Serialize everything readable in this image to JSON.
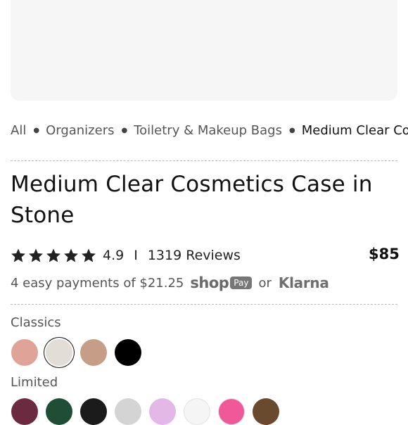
{
  "breadcrumb": {
    "items": [
      "All",
      "Organizers",
      "Toiletry & Makeup Bags",
      "Medium Clear Cosmetics Case in Stone"
    ]
  },
  "product": {
    "title": "Medium Clear Cosmetics Case in Stone",
    "rating": "4.9",
    "rating_stars": 5,
    "rating_separator": "I",
    "reviews": "1319 Reviews",
    "price": "$85"
  },
  "installments": {
    "text": "4 easy payments of $21.25",
    "shop_label": "shop",
    "pay_label": "Pay",
    "or": "or",
    "klarna": "Klarna"
  },
  "colors": {
    "classics_label": "Classics",
    "classics": [
      "#dfa398",
      "#e3ddd8",
      "#c69d86",
      "#000000"
    ],
    "classics_selected_index": 1,
    "limited_label": "Limited",
    "limited": [
      "#6b2a3f",
      "#1f4d36",
      "#1b1b1b",
      "#d4d4d4",
      "#e4b8e6",
      "#f5f5f5",
      "#f0589a",
      "#6a4a2f"
    ]
  },
  "accent_color": "#111111"
}
